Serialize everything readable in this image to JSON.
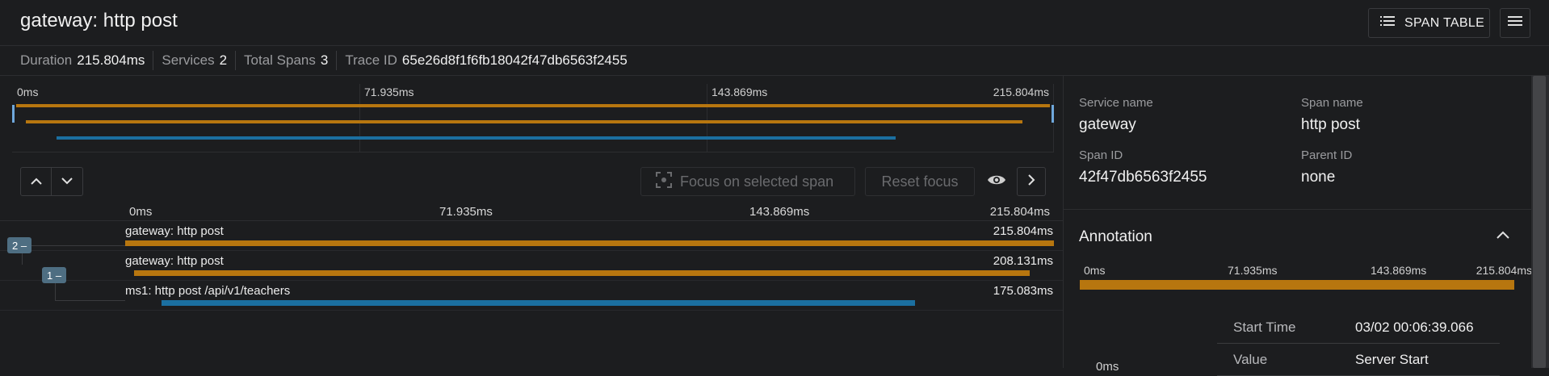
{
  "header": {
    "title": "gateway: http post",
    "span_table_label": "SPAN TABLE",
    "menu_icon": "hamburger-menu-icon"
  },
  "stats": [
    {
      "label": "Duration",
      "value": "215.804ms"
    },
    {
      "label": "Services",
      "value": "2"
    },
    {
      "label": "Total Spans",
      "value": "3"
    },
    {
      "label": "Trace ID",
      "value": "65e26d8f1f6fb18042f47db6563f2455"
    }
  ],
  "minimap": {
    "ticks": [
      "0ms",
      "71.935ms",
      "143.869ms",
      "215.804ms"
    ]
  },
  "controls": {
    "focus_label": "Focus on selected span",
    "reset_label": "Reset focus"
  },
  "timeline": {
    "ticks": [
      "0ms",
      "71.935ms",
      "143.869ms",
      "215.804ms"
    ],
    "total_ms": 215.804,
    "spans": [
      {
        "name": "gateway: http post",
        "duration": "215.804ms",
        "start_ms": 0,
        "dur_ms": 215.804,
        "color": "#b7760f",
        "badge": "2 –"
      },
      {
        "name": "gateway: http post",
        "duration": "208.131ms",
        "start_ms": 2.0,
        "dur_ms": 208.131,
        "color": "#b7760f",
        "badge": "1 –"
      },
      {
        "name": "ms1: http post /api/v1/teachers",
        "duration": "175.083ms",
        "start_ms": 8.5,
        "dur_ms": 175.083,
        "color": "#1b6fa0",
        "badge": ""
      }
    ]
  },
  "detail": {
    "service_name_label": "Service name",
    "service_name": "gateway",
    "span_name_label": "Span name",
    "span_name": "http post",
    "span_id_label": "Span ID",
    "span_id": "42f47db6563f2455",
    "parent_id_label": "Parent ID",
    "parent_id": "none",
    "annotation_title": "Annotation",
    "annotation_ticks": [
      "0ms",
      "71.935ms",
      "143.869ms",
      "215.804ms"
    ],
    "annotation_rows": [
      {
        "key": "Start Time",
        "value": "03/02 00:06:39.066"
      },
      {
        "key": "Value",
        "value": "Server Start"
      }
    ],
    "annotation_zero": "0ms"
  },
  "colors": {
    "gateway": "#b7760f",
    "ms1": "#1b6fa0",
    "background": "#1c1d1f"
  }
}
